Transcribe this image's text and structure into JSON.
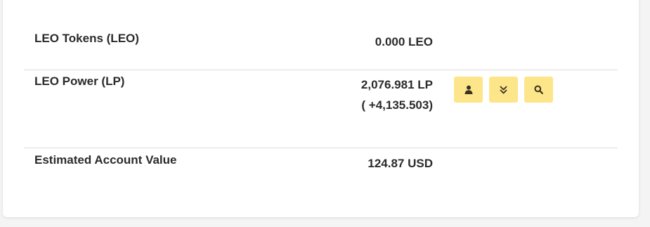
{
  "rows": [
    {
      "label": "LEO Tokens (LEO)",
      "value": "0.000 LEO"
    },
    {
      "label": "LEO Power (LP)",
      "value": "2,076.981 LP",
      "value_sub": "( +4,135.503)"
    },
    {
      "label": "Estimated Account Value",
      "value": "124.87 USD"
    }
  ],
  "actions": [
    {
      "icon": "user-icon"
    },
    {
      "icon": "double-chevron-down-icon"
    },
    {
      "icon": "search-icon"
    }
  ],
  "colors": {
    "button_bg": "#fde58a",
    "text": "#2b2b2b",
    "divider": "#dcdcdc"
  }
}
